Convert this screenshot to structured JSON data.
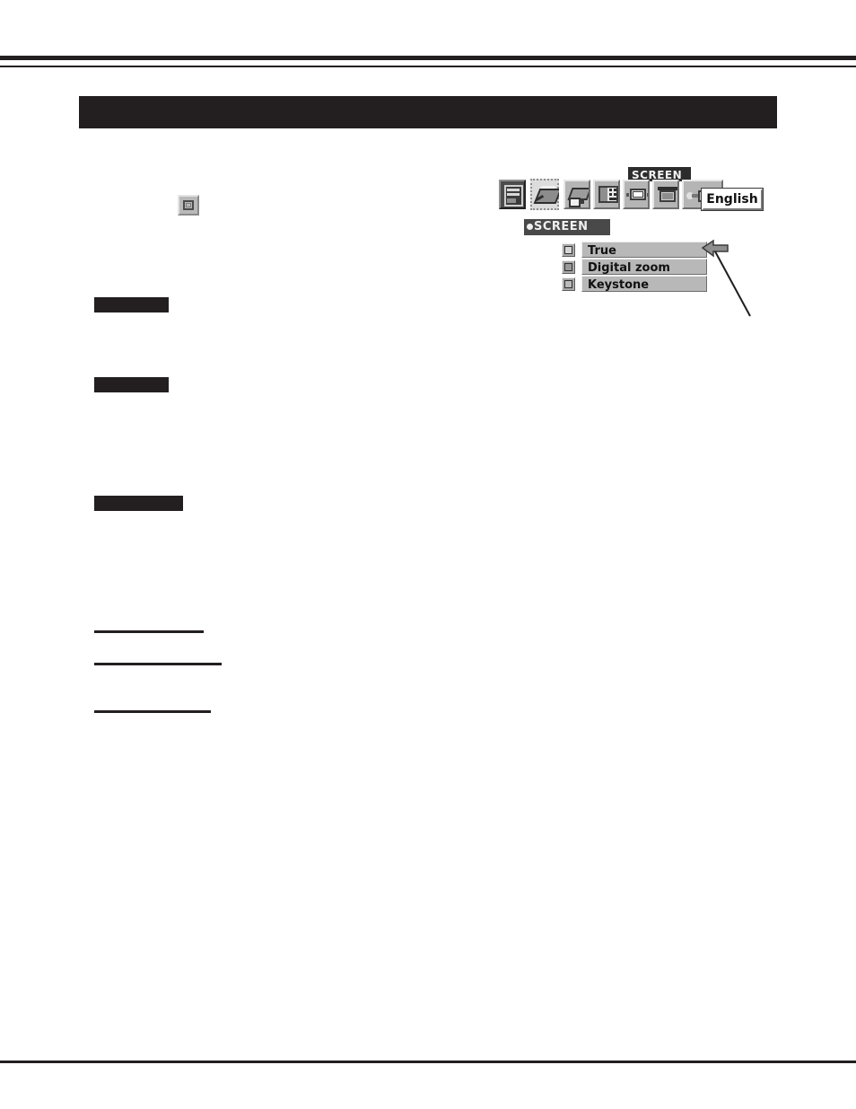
{
  "page": {
    "title_bar_text": "",
    "header_rule": "double-rule",
    "footer_rule": "single-rule"
  },
  "body_sections": [
    {
      "id": "section-1",
      "heading": ""
    },
    {
      "id": "section-2",
      "heading": ""
    },
    {
      "id": "section-3",
      "heading": ""
    }
  ],
  "terms": [
    {
      "id": "term-1",
      "label": ""
    },
    {
      "id": "term-2",
      "label": ""
    },
    {
      "id": "term-3",
      "label": ""
    }
  ],
  "inline_icon": {
    "name": "keystone-icon",
    "label": ""
  },
  "osd": {
    "tooltip": "SCREEN",
    "language_button": "English",
    "section_header": "SCREEN",
    "menu_icons": [
      {
        "name": "input-source-icon",
        "state": "dark"
      },
      {
        "name": "image-select-icon",
        "state": "selected"
      },
      {
        "name": "image-adjust-icon",
        "state": "normal"
      },
      {
        "name": "pc-adjust-icon",
        "state": "normal"
      },
      {
        "name": "screen-icon",
        "state": "normal"
      },
      {
        "name": "setting-icon",
        "state": "normal"
      },
      {
        "name": "sound-icon",
        "state": "normal"
      }
    ],
    "menu_items": [
      {
        "icon": "true-size-icon",
        "label": "True"
      },
      {
        "icon": "digital-zoom-icon",
        "label": "Digital zoom"
      },
      {
        "icon": "keystone-icon",
        "label": "Keystone"
      }
    ],
    "callout": {
      "name": "pointer-arrow",
      "direction": "left",
      "note": ""
    }
  },
  "colors": {
    "ink": "#231f20",
    "osd_face": "#b8b8b8",
    "osd_dark": "#4c4c4c",
    "osd_header": "#494949",
    "osd_text": "#111111",
    "page_bg": "#ffffff"
  }
}
